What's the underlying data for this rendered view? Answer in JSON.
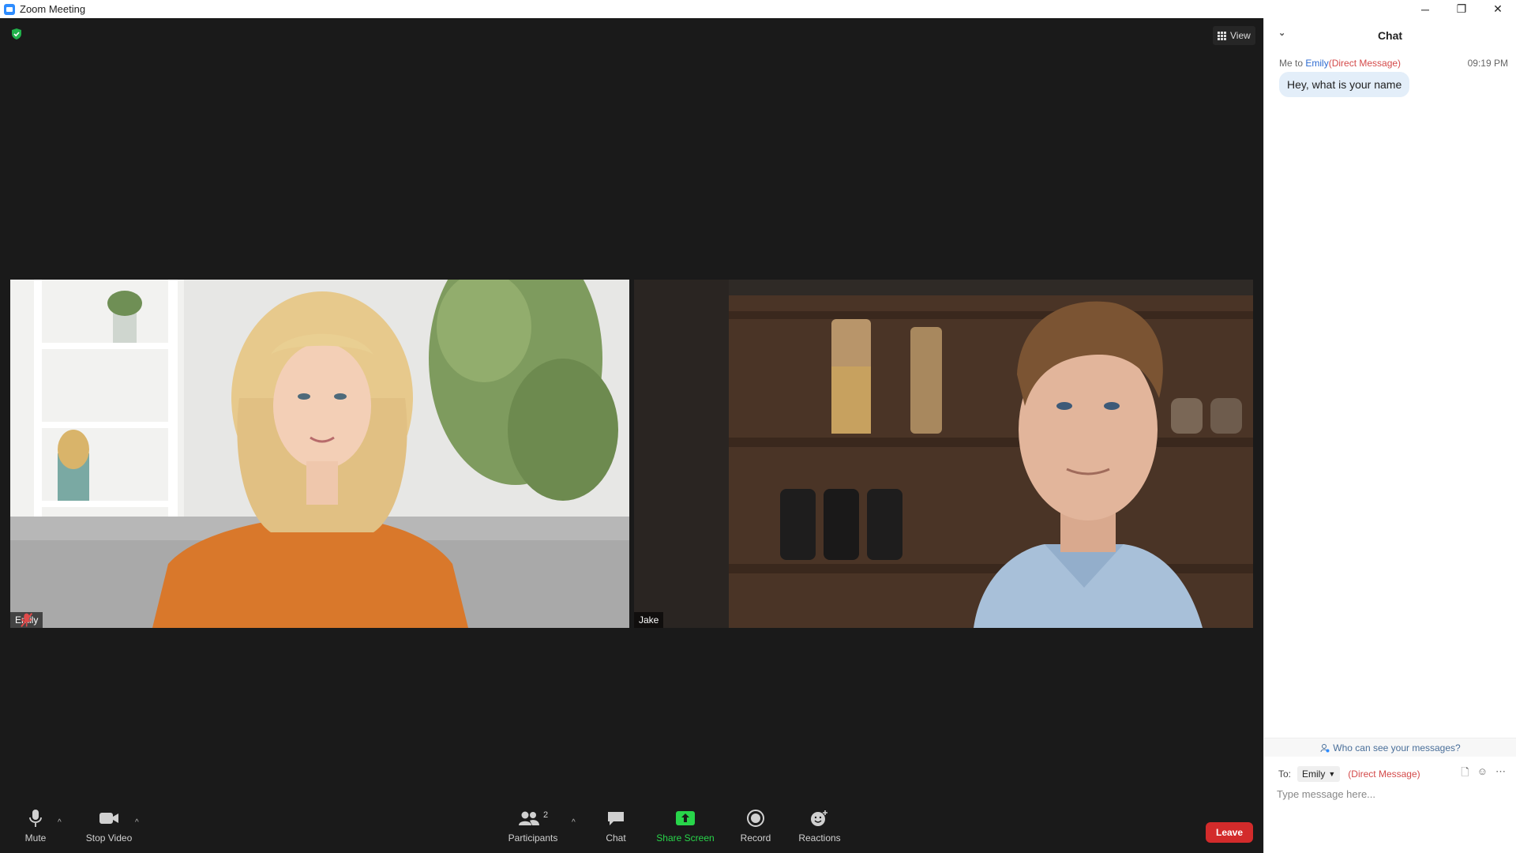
{
  "window": {
    "title": "Zoom Meeting",
    "controls": {
      "minimize": "─",
      "restore": "❐",
      "close": "✕"
    }
  },
  "meeting": {
    "view_label": "View",
    "participants": [
      {
        "name": "Emily",
        "muted": true
      },
      {
        "name": "Jake",
        "muted": false
      }
    ]
  },
  "toolbar": {
    "mute_label": "Mute",
    "stop_video_label": "Stop Video",
    "participants_label": "Participants",
    "participants_count": "2",
    "chat_label": "Chat",
    "share_label": "Share Screen",
    "record_label": "Record",
    "reactions_label": "Reactions",
    "leave_label": "Leave",
    "caret": "^"
  },
  "chat": {
    "title": "Chat",
    "message": {
      "from": "Me to ",
      "to": "Emily",
      "dm": "(Direct Message)",
      "time": "09:19 PM",
      "text": "Hey, what is your name"
    },
    "who_can_see": "Who can see your messages?",
    "to_label": "To:",
    "to_selected": "Emily",
    "to_dm": "(Direct Message)",
    "input_placeholder": "Type message here..."
  },
  "colors": {
    "meeting_bg": "#1a1a1a",
    "share_green": "#28d54a",
    "leave_red": "#d32b2b",
    "link_blue": "#2d6bd1",
    "dm_red": "#d44a4a"
  }
}
